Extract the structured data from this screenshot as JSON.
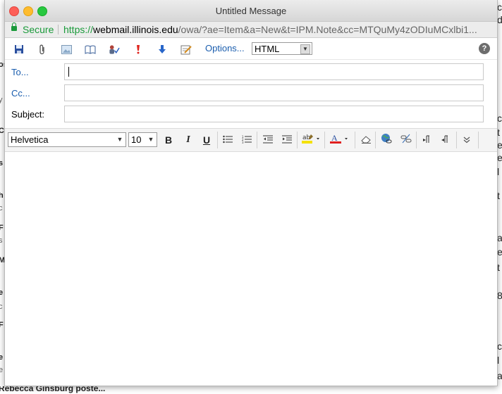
{
  "window": {
    "title": "Untitled Message"
  },
  "addressbar": {
    "secure_label": "Secure",
    "url_protocol": "https://",
    "url_host": "webmail.illinois.edu",
    "url_path": "/owa/?ae=Item&a=New&t=IPM.Note&cc=MTQuMy4zODIuMCxlbi1..."
  },
  "toolbar": {
    "options_label": "Options...",
    "format_value": "HTML",
    "icons": [
      "save-icon",
      "attach-icon",
      "image-icon",
      "address-book-icon",
      "check-names-icon",
      "importance-high-icon",
      "importance-low-icon",
      "signature-icon"
    ]
  },
  "header": {
    "to_label": "To...",
    "cc_label": "Cc...",
    "subject_label": "Subject:",
    "to_value": "",
    "cc_value": "",
    "subject_value": ""
  },
  "formatting": {
    "font_family": "Helvetica",
    "font_size": "10"
  },
  "background": {
    "bottom_text": "Rebecca Ginsburg poste...",
    "left_fragments": [
      "os",
      "y",
      "C",
      "s",
      "h",
      "F",
      "s",
      "M",
      "e",
      "F",
      "e",
      "e",
      "c",
      "c"
    ],
    "right_fragments": [
      "cl",
      "d",
      "cl",
      "t",
      "e",
      "e",
      "l",
      "t",
      "a",
      "e",
      "t",
      "8",
      "c",
      "l",
      "a"
    ]
  },
  "colors": {
    "secure_green": "#1a9a3a",
    "link_blue": "#1a5dae",
    "highlight_yellow": "#f4e100",
    "font_color_red": "#e02020"
  }
}
